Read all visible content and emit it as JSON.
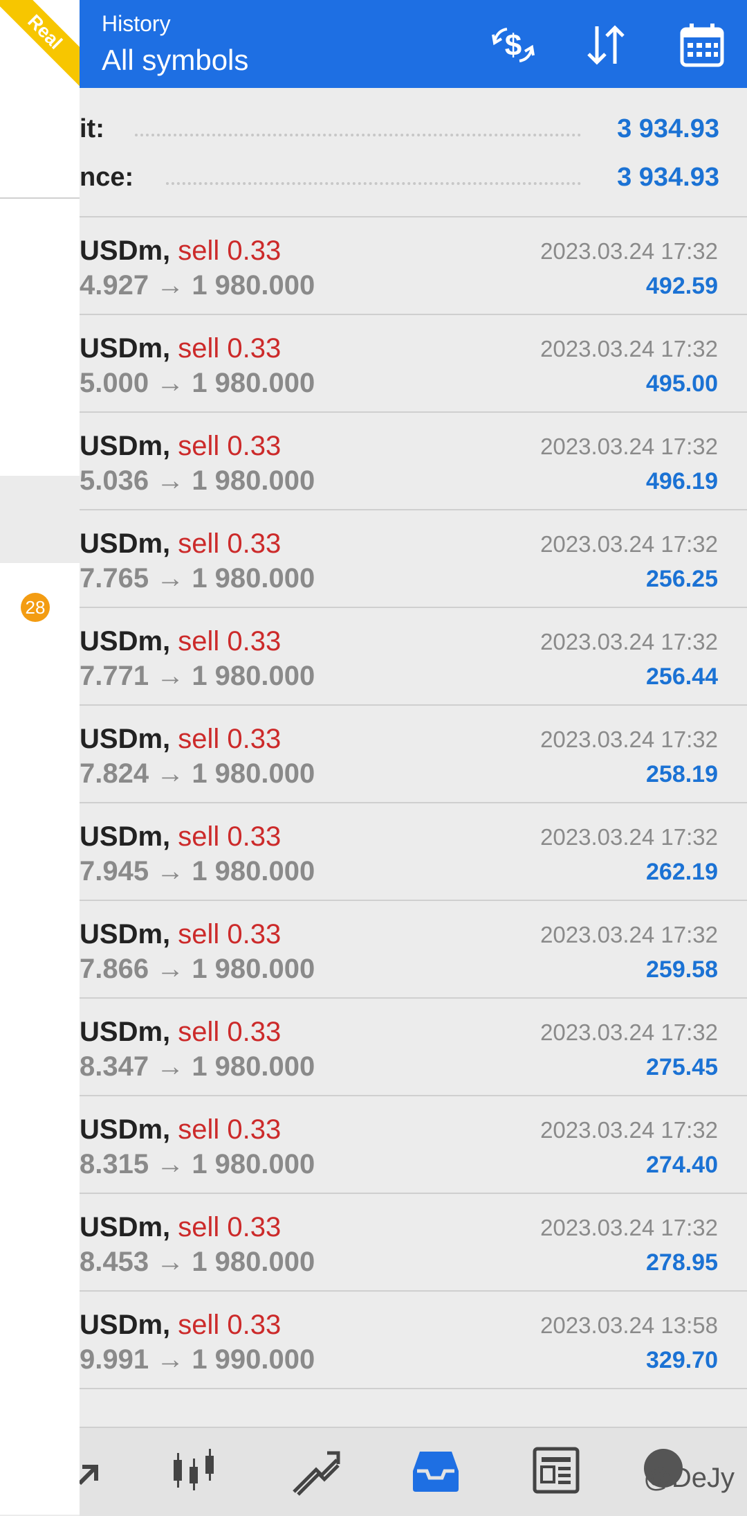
{
  "account_badge": "Real",
  "notification_count": "28",
  "header": {
    "subtitle": "History",
    "title": "All symbols"
  },
  "summary": [
    {
      "label": "it:",
      "value": "3 934.93"
    },
    {
      "label": "nce:",
      "value": "3 934.93"
    }
  ],
  "deals": [
    {
      "symbol": "USDm,",
      "side": "sell 0.33",
      "prices": "4.927 → 1 980.000",
      "time": "2023.03.24 17:32",
      "profit": "492.59"
    },
    {
      "symbol": "USDm,",
      "side": "sell 0.33",
      "prices": "5.000 → 1 980.000",
      "time": "2023.03.24 17:32",
      "profit": "495.00"
    },
    {
      "symbol": "USDm,",
      "side": "sell 0.33",
      "prices": "5.036 → 1 980.000",
      "time": "2023.03.24 17:32",
      "profit": "496.19"
    },
    {
      "symbol": "USDm,",
      "side": "sell 0.33",
      "prices": "7.765 → 1 980.000",
      "time": "2023.03.24 17:32",
      "profit": "256.25"
    },
    {
      "symbol": "USDm,",
      "side": "sell 0.33",
      "prices": "7.771 → 1 980.000",
      "time": "2023.03.24 17:32",
      "profit": "256.44"
    },
    {
      "symbol": "USDm,",
      "side": "sell 0.33",
      "prices": "7.824 → 1 980.000",
      "time": "2023.03.24 17:32",
      "profit": "258.19"
    },
    {
      "symbol": "USDm,",
      "side": "sell 0.33",
      "prices": "7.945 → 1 980.000",
      "time": "2023.03.24 17:32",
      "profit": "262.19"
    },
    {
      "symbol": "USDm,",
      "side": "sell 0.33",
      "prices": "7.866 → 1 980.000",
      "time": "2023.03.24 17:32",
      "profit": "259.58"
    },
    {
      "symbol": "USDm,",
      "side": "sell 0.33",
      "prices": "8.347 → 1 980.000",
      "time": "2023.03.24 17:32",
      "profit": "275.45"
    },
    {
      "symbol": "USDm,",
      "side": "sell 0.33",
      "prices": "8.315 → 1 980.000",
      "time": "2023.03.24 17:32",
      "profit": "274.40"
    },
    {
      "symbol": "USDm,",
      "side": "sell 0.33",
      "prices": "8.453 → 1 980.000",
      "time": "2023.03.24 17:32",
      "profit": "278.95"
    },
    {
      "symbol": "USDm,",
      "side": "sell 0.33",
      "prices": "9.991 → 1 990.000",
      "time": "2023.03.24 13:58",
      "profit": "329.70"
    }
  ],
  "watermark": "@DeJy",
  "colors": {
    "header": "#1e6fe3",
    "sell": "#cc2a2a",
    "profit": "#1b72d4",
    "badge": "#f7c600"
  },
  "icons": [
    "currency-exchange-icon",
    "sort-icon",
    "calendar-icon",
    "quotes-icon",
    "chart-icon",
    "trade-icon",
    "history-icon",
    "news-icon",
    "chat-icon"
  ]
}
